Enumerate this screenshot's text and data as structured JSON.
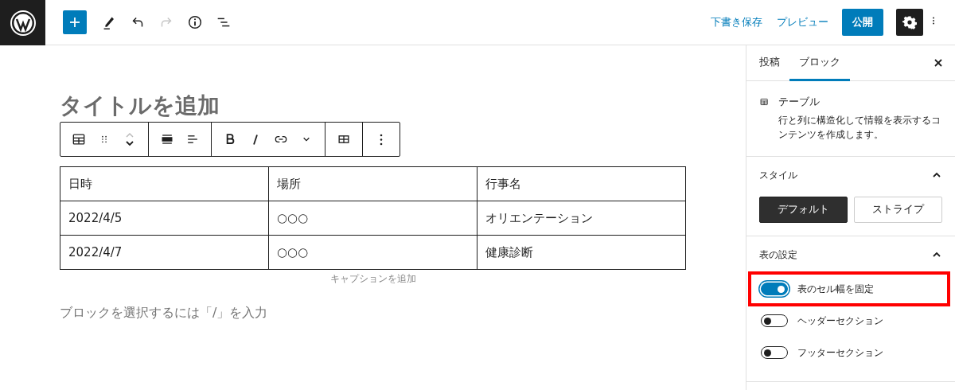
{
  "top_bar": {
    "tools": [
      {
        "kind": "inserter",
        "disabled": false
      },
      {
        "kind": "edit",
        "disabled": false
      },
      {
        "kind": "undo",
        "disabled": false
      },
      {
        "kind": "redo",
        "disabled": true
      },
      {
        "kind": "info",
        "disabled": false
      },
      {
        "kind": "outline",
        "disabled": false
      }
    ],
    "save_draft": "下書き保存",
    "preview": "プレビュー",
    "publish": "公開",
    "settings_active": true
  },
  "editor": {
    "title_placeholder": "タイトルを追加",
    "table": {
      "rows": [
        [
          "日時",
          "場所",
          "行事名"
        ],
        [
          "2022/4/5",
          "○○○",
          "オリエンテーション"
        ],
        [
          "2022/4/7",
          "○○○",
          "健康診断"
        ]
      ]
    },
    "caption_placeholder": "キャプションを追加",
    "appender_placeholder": "ブロックを選択するには「/」を入力"
  },
  "sidebar": {
    "tabs": [
      {
        "label": "投稿",
        "selected": false
      },
      {
        "label": "ブロック",
        "selected": true
      }
    ],
    "block_card": {
      "title": "テーブル",
      "description": "行と列に構造化して情報を表示するコンテンツを作成します。"
    },
    "style_panel": {
      "title": "スタイル",
      "expanded": true,
      "options": [
        {
          "label": "デフォルト",
          "selected": true
        },
        {
          "label": "ストライプ",
          "selected": false
        }
      ]
    },
    "settings_panel": {
      "title": "表の設定",
      "expanded": true,
      "toggles": [
        {
          "label": "表のセル幅を固定",
          "on": true,
          "highlighted": true
        },
        {
          "label": "ヘッダーセクション",
          "on": false,
          "highlighted": false
        },
        {
          "label": "フッターセクション",
          "on": false,
          "highlighted": false
        }
      ]
    }
  }
}
